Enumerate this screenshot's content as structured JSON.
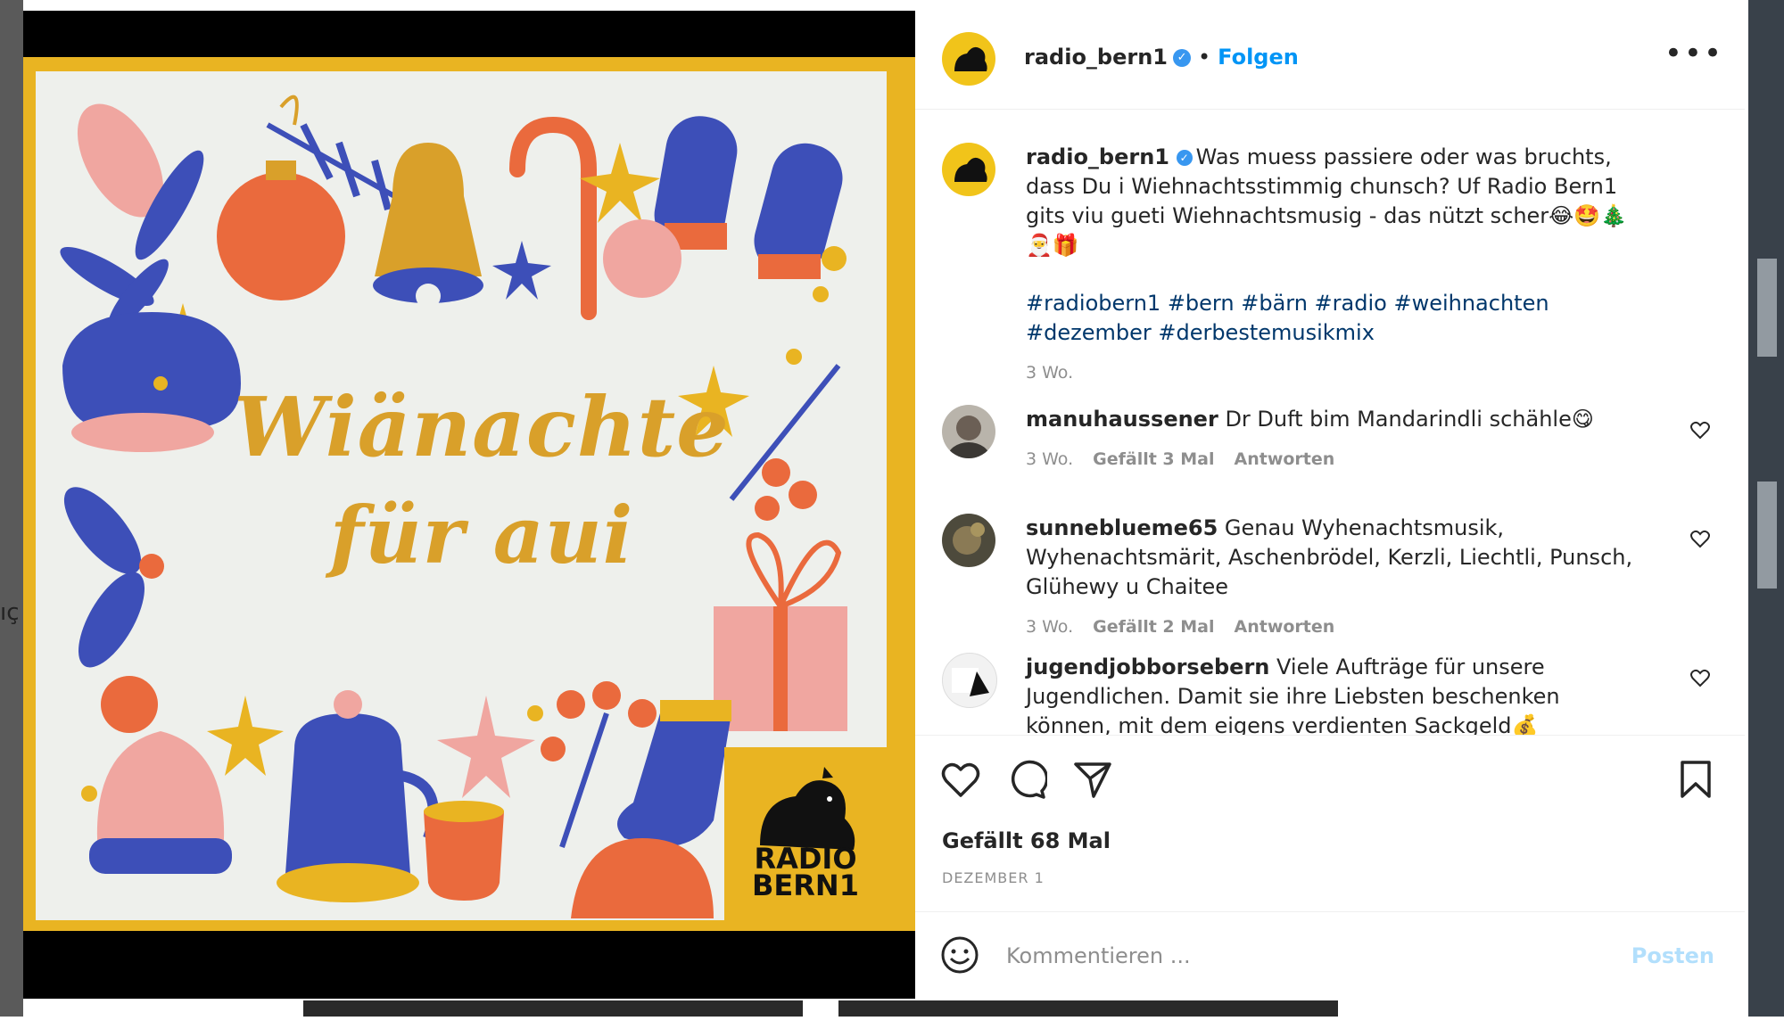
{
  "page": {
    "partial_text_left": "ıç"
  },
  "post": {
    "headline_line1": "Wiänachte",
    "headline_line2": "für aui",
    "logo_line1": "RADIO",
    "logo_line2": "BERN1"
  },
  "header": {
    "username": "radio_bern1",
    "verified_glyph": "✓",
    "separator": "•",
    "follow_label": "Folgen",
    "more_label": "•••"
  },
  "caption": {
    "username": "radio_bern1",
    "text": "Was muess passiere oder was bruchts, dass Du i Wiehnachtsstimmig chunsch? Uf Radio Bern1 gits viu gueti Wiehnachtsmusig - das nützt scher😂🤩🎄🎅🎁",
    "hashtags": "#radiobern1 #bern #bärn #radio #weihnachten #dezember #derbestemusikmix",
    "time": "3 Wo."
  },
  "comments": [
    {
      "username": "manuhaussener",
      "text": "Dr Duft bim Mandarindli schähle😋",
      "time": "3 Wo.",
      "likes": "Gefällt 3 Mal",
      "reply": "Antworten"
    },
    {
      "username": "sunneblueme65",
      "text": "Genau Wyhenachtsmusik, Wyhenachtsmärit, Aschenbrödel, Kerzli, Liechtli, Punsch, Glühewy u Chaitee",
      "time": "3 Wo.",
      "likes": "Gefällt 2 Mal",
      "reply": "Antworten"
    },
    {
      "username": "jugendjobborsebern",
      "text": "Viele Aufträge für unsere Jugendlichen. Damit sie ihre Liebsten beschenken können, mit dem eigens verdienten Sackgeld💰"
    }
  ],
  "footer": {
    "likes_text": "Gefällt 68 Mal",
    "date_text": "DEZEMBER 1",
    "comment_placeholder": "Kommentieren ...",
    "post_label": "Posten"
  },
  "colors": {
    "accent": "#0095f6",
    "post_frame": "#e9b422",
    "headline": "#d9a02a"
  },
  "icons": [
    "heart-icon",
    "comment-icon",
    "share-icon",
    "bookmark-icon",
    "emoji-icon",
    "verified-icon"
  ]
}
